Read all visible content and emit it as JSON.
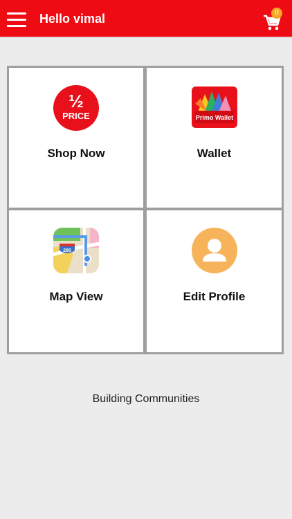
{
  "header": {
    "title": "Hello vimal",
    "cart_count": "0",
    "menu_icon": "hamburger-icon",
    "cart_icon": "shopping-cart-icon"
  },
  "tiles": [
    {
      "label": "Shop Now",
      "icon": "half-price-icon",
      "icon_text_top": "½",
      "icon_text_bottom": "PRICE"
    },
    {
      "label": "Wallet",
      "icon": "primo-wallet-icon",
      "icon_text": "Primo Wallet"
    },
    {
      "label": "Map View",
      "icon": "map-icon",
      "icon_text": "280"
    },
    {
      "label": "Edit Profile",
      "icon": "profile-avatar-icon"
    }
  ],
  "footer": {
    "text": "Building Communities"
  },
  "colors": {
    "header_red": "#ee0b13",
    "badge_orange": "#f6a623",
    "profile_orange": "#f7b35a"
  }
}
